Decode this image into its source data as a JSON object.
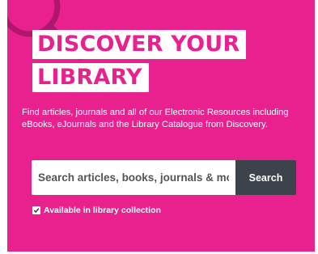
{
  "hero": {
    "title_line_1": "DISCOVER YOUR",
    "title_line_2": "LIBRARY",
    "description": "Find articles, journals and all of our Electronic Resources including eBooks, eJournals and the Library Catalogue from Discovery.",
    "decoration_icon": "magnifier-icon"
  },
  "search": {
    "placeholder": "Search articles, books, journals & more",
    "value": "",
    "button_label": "Search"
  },
  "filter": {
    "label": "Available in library collection",
    "checked": true,
    "check_icon": "checkmark-icon"
  },
  "colors": {
    "panel_background": "#e8218f",
    "title_text": "#e8218f",
    "title_highlight": "#ffffff",
    "search_button_background": "#3d434a",
    "magnifier_stroke": "#b0176c"
  }
}
